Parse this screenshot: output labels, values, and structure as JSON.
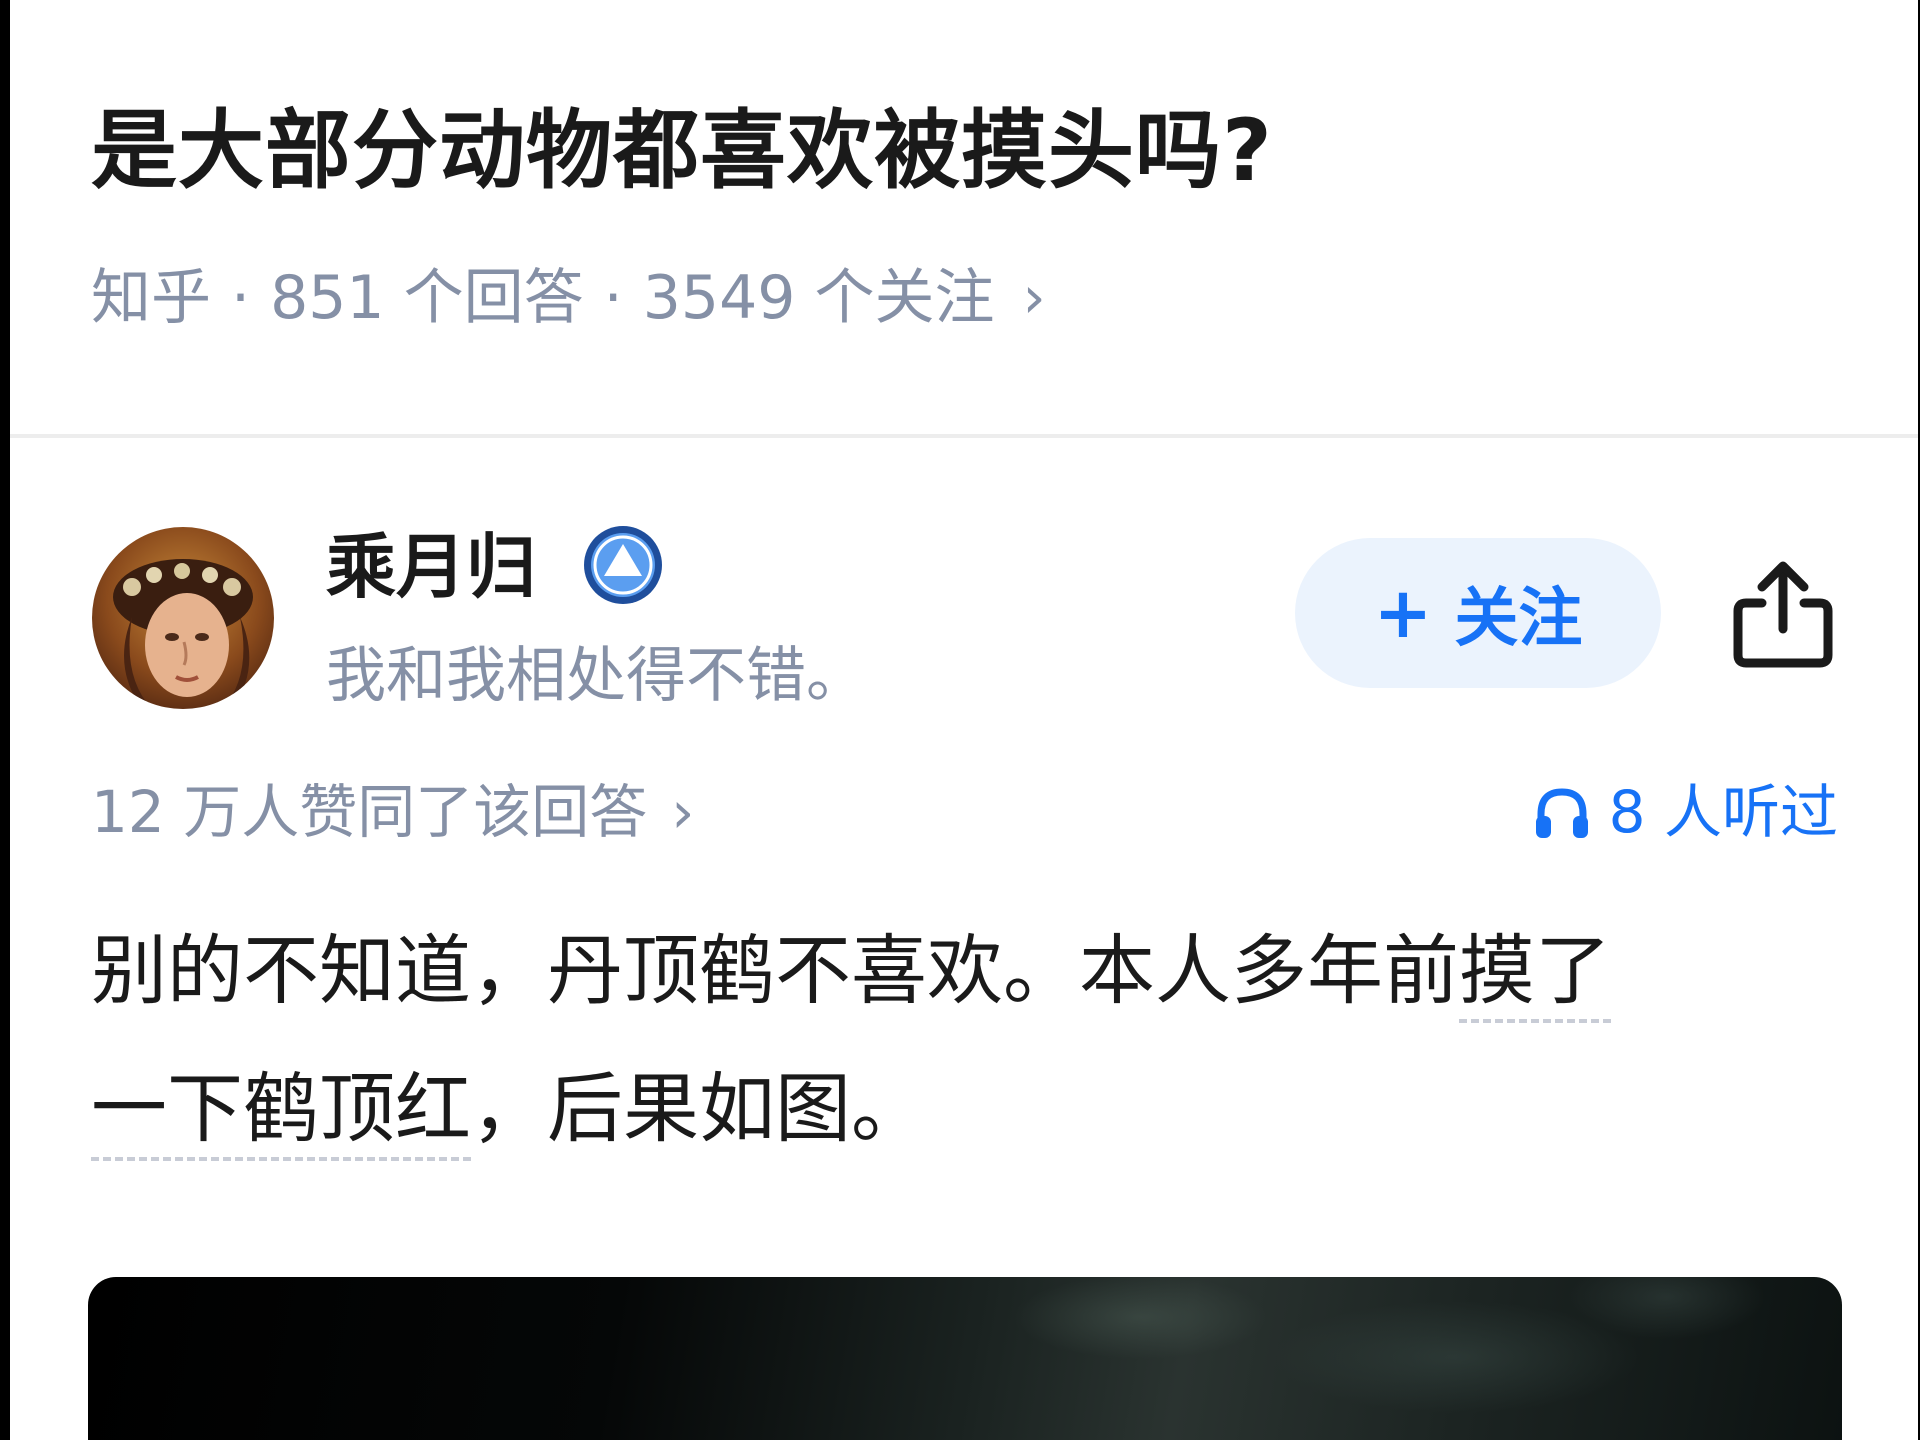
{
  "question": {
    "title": "是大部分动物都喜欢被摸头吗?",
    "source": "知乎",
    "separator": "·",
    "answers": "851 个回答",
    "followers": "3549 个关注",
    "chevron": "›"
  },
  "author": {
    "name": "乘月归",
    "bio": "我和我相处得不错。",
    "avatar_icon": "portrait-avatar",
    "badge_icon": "verified-badge-icon"
  },
  "actions": {
    "follow_plus": "+",
    "follow_label": "关注",
    "share_icon": "share-icon"
  },
  "stats": {
    "votes": "12 万人赞同了该回答",
    "votes_chevron": "›",
    "listened": "8 人听过",
    "listened_icon": "headphones-icon"
  },
  "answer": {
    "line1_a": "别的不知道，丹顶鹤不喜欢。本人多年前",
    "line1_link": "摸了",
    "line2_link": "一下鹤顶红",
    "line2_b": "，后果如图。"
  },
  "colors": {
    "accent": "#1772f6",
    "meta_gray": "#8590a6",
    "text": "#1a1a1a",
    "follow_bg": "#ebf3fd"
  }
}
